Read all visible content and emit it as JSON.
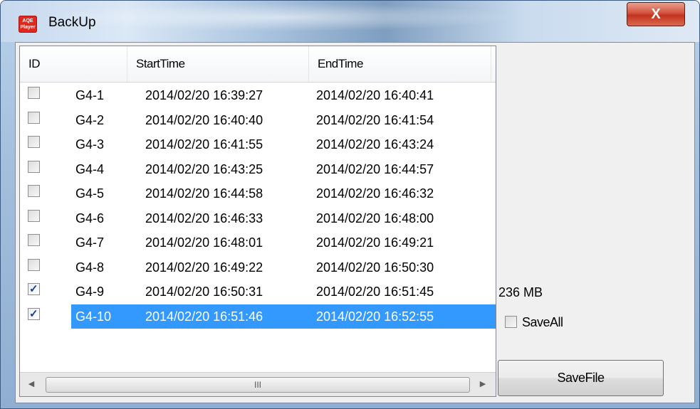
{
  "window": {
    "title": "BackUp",
    "icon": "app-logo-icon",
    "close_label": "X"
  },
  "table": {
    "columns": [
      {
        "label": "ID"
      },
      {
        "label": ""
      },
      {
        "label": "StartTime"
      },
      {
        "label": "EndTime"
      }
    ],
    "rows": [
      {
        "checked": false,
        "id": "G4-1",
        "start": "2014/02/20 16:39:27",
        "end": "2014/02/20 16:40:41"
      },
      {
        "checked": false,
        "id": "G4-2",
        "start": "2014/02/20 16:40:40",
        "end": "2014/02/20 16:41:54"
      },
      {
        "checked": false,
        "id": "G4-3",
        "start": "2014/02/20 16:41:55",
        "end": "2014/02/20 16:43:24"
      },
      {
        "checked": false,
        "id": "G4-4",
        "start": "2014/02/20 16:43:25",
        "end": "2014/02/20 16:44:57"
      },
      {
        "checked": false,
        "id": "G4-5",
        "start": "2014/02/20 16:44:58",
        "end": "2014/02/20 16:46:32"
      },
      {
        "checked": false,
        "id": "G4-6",
        "start": "2014/02/20 16:46:33",
        "end": "2014/02/20 16:48:00"
      },
      {
        "checked": false,
        "id": "G4-7",
        "start": "2014/02/20 16:48:01",
        "end": "2014/02/20 16:49:21"
      },
      {
        "checked": false,
        "id": "G4-8",
        "start": "2014/02/20 16:49:22",
        "end": "2014/02/20 16:50:30"
      },
      {
        "checked": true,
        "id": "G4-9",
        "start": "2014/02/20 16:50:31",
        "end": "2014/02/20 16:51:45"
      },
      {
        "checked": true,
        "id": "G4-10",
        "start": "2014/02/20 16:51:46",
        "end": "2014/02/20 16:52:55",
        "selected": true
      }
    ],
    "scrollbar": {
      "thumb_grip": "III"
    }
  },
  "panel": {
    "size_text": "236  MB",
    "saveall_label": "SaveAll",
    "saveall_checked": false,
    "savefile_label": "SaveFile"
  }
}
